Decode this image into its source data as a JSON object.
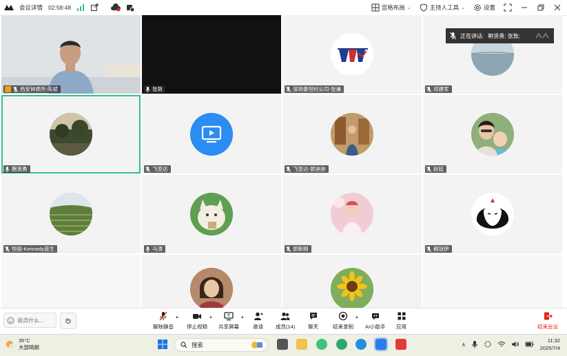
{
  "topbar": {
    "meeting_info": "会议详情",
    "timer": "02:58:48",
    "layout_label": "宫格布局",
    "host_tools_label": "主持人工具",
    "settings_label": "设置"
  },
  "speaking": {
    "label": "正在讲话:",
    "names": "鲍贤勇; 张敖;"
  },
  "participants": [
    {
      "name": "西安钟表所-陈斌",
      "host": true
    },
    {
      "name": "张敖"
    },
    {
      "name": "深圳泰坦时公司-张谦"
    },
    {
      "name": "邓建军"
    },
    {
      "name": "鲍贤勇",
      "active": true
    },
    {
      "name": "飞亚达"
    },
    {
      "name": "飞亚达-郭迪迪"
    },
    {
      "name": "赵延"
    },
    {
      "name": "恒丽-Kennedy蓝生"
    },
    {
      "name": "马涛"
    },
    {
      "name": "郭新刚"
    },
    {
      "name": "赖冠伊"
    },
    {
      "name": ""
    },
    {
      "name": ""
    }
  ],
  "toolbar": {
    "chat_placeholder": "说点什么...",
    "unmute": "解除静音",
    "stop_video": "停止视频",
    "share_screen": "共享屏幕",
    "invite": "邀请",
    "members": "成员(14)",
    "chat": "聊天",
    "end_record": "结束录制",
    "ai_assistant": "AI小助手",
    "apps": "应用",
    "end_meeting": "结束会议"
  },
  "taskbar": {
    "temperature": "35°C",
    "weather": "大部晴朗",
    "search_label": "搜索",
    "time": "11:32",
    "date": "2025/7/4"
  },
  "colors": {
    "active_border": "#2fbf83",
    "end_red": "#e1251b",
    "tile_bg": "#f3f3f3"
  }
}
